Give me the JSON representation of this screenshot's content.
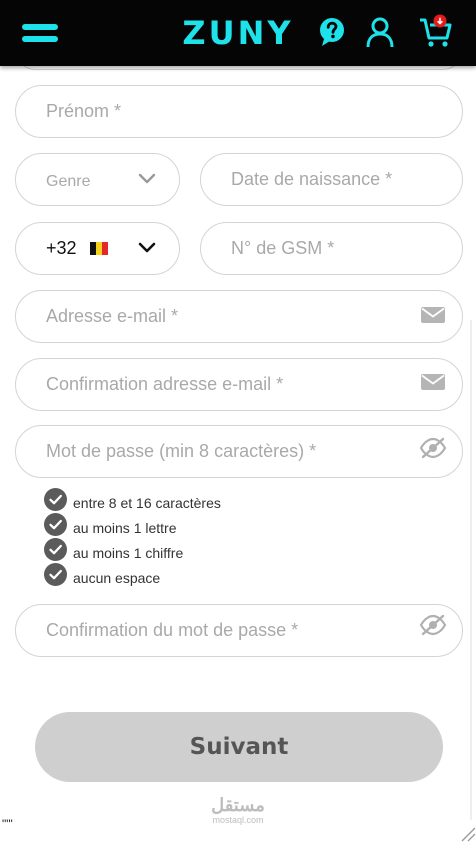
{
  "header": {
    "logo": "ZUNY",
    "brand_color": "#1de2ea",
    "bar_color": "#050505",
    "icons": [
      "menu-icon",
      "help-icon",
      "user-icon",
      "cart-icon"
    ]
  },
  "form": {
    "prenom_placeholder": "Prénom *",
    "genre_placeholder": "Genre",
    "birthdate_placeholder": "Date de naissance *",
    "phone_code": "+32",
    "phone_flag": "belgium-flag",
    "gsm_placeholder": "N° de GSM *",
    "email_placeholder": "Adresse e-mail *",
    "email_confirm_placeholder": "Confirmation adresse e-mail *",
    "password_placeholder": "Mot de passe (min 8 caractères) *",
    "password_rules": [
      "entre 8 et 16 caractères",
      "au moins 1 lettre",
      "au moins 1 chiffre",
      "aucun espace"
    ],
    "password_confirm_placeholder": "Confirmation du mot de passe *",
    "submit_label": "Suivant"
  },
  "watermark": {
    "arabic": "مستقل",
    "latin": "mostaql.com"
  },
  "corner_text": "\"\"'"
}
